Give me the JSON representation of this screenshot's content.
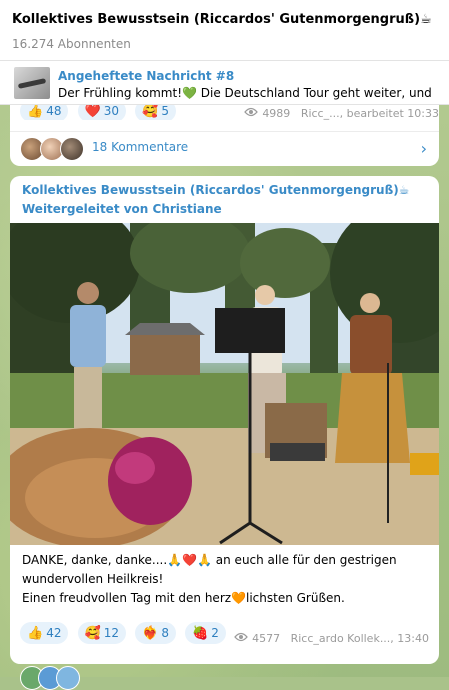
{
  "channel": {
    "title": "Kollektives Bewusstsein (Riccardos' Gutenmorgengruß)☕",
    "subscribers": "16.274 Abonnenten"
  },
  "pinned": {
    "title": "Angeheftete Nachricht #8",
    "text_before": "Der Frühling kommt!",
    "heart": "💚",
    "text_after": " Die Deutschland Tour geht weiter, und"
  },
  "prev_message": {
    "reactions": [
      {
        "emoji": "👍",
        "count": "48"
      },
      {
        "emoji": "❤️",
        "count": "30"
      },
      {
        "emoji": "🥰",
        "count": "5"
      }
    ],
    "views": "4989",
    "author_edited": "Ricc_..., bearbeitet 10:33",
    "comments_label": "18 Kommentare",
    "comments_chevron": "›"
  },
  "message": {
    "title": "Kollektives Bewusstsein (Riccardos' Gutenmorgengruß)☕",
    "forwarded": "Weitergeleitet von Christiane",
    "caption_line1": "DANKE, danke, danke....🙏❤️🙏 an euch alle für den gestrigen",
    "caption_line2": "wundervollen  Heilkreis!",
    "caption_line3": "Einen freudvollen Tag mit den herz🧡lichsten Grüßen.",
    "reactions": [
      {
        "emoji": "👍",
        "count": "42"
      },
      {
        "emoji": "🥰",
        "count": "12"
      },
      {
        "emoji": "❤️‍🔥",
        "count": "8"
      },
      {
        "emoji": "🍓",
        "count": "2"
      }
    ],
    "views": "4577",
    "author_time": "Ricc_ardo Kollek..., 13:40"
  },
  "colors": {
    "accent": "#3a8bc7",
    "chip_bg": "#e7f2fb",
    "meta_gray": "#9b9b9b"
  }
}
